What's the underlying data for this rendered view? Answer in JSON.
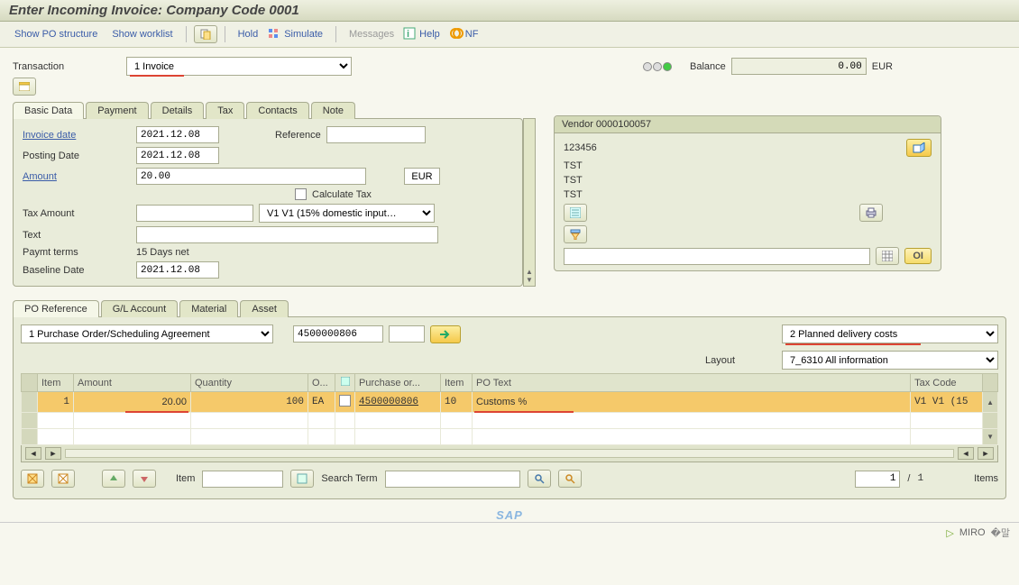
{
  "title": "Enter Incoming Invoice: Company Code 0001",
  "toolbar": {
    "show_po": "Show PO structure",
    "show_worklist": "Show worklist",
    "hold": "Hold",
    "simulate": "Simulate",
    "messages": "Messages",
    "help": "Help",
    "nf": "NF"
  },
  "transaction_lbl": "Transaction",
  "transaction_val": "1 Invoice",
  "balance_lbl": "Balance",
  "balance_val": "0.00",
  "balance_cur": "EUR",
  "tabs1": {
    "basic": "Basic Data",
    "payment": "Payment",
    "details": "Details",
    "tax": "Tax",
    "contacts": "Contacts",
    "note": "Note"
  },
  "basic": {
    "invoice_date_lbl": "Invoice date",
    "invoice_date": "2021.12.08",
    "reference_lbl": "Reference",
    "reference": "",
    "posting_date_lbl": "Posting Date",
    "posting_date": "2021.12.08",
    "amount_lbl": "Amount",
    "amount": "20.00",
    "amount_cur": "EUR",
    "calc_tax_lbl": "Calculate Tax",
    "tax_amount_lbl": "Tax Amount",
    "tax_amount": "",
    "tax_code": "V1 V1 (15% domestic input…",
    "text_lbl": "Text",
    "text": "",
    "paymt_lbl": "Paymt terms",
    "paymt": "15 Days net",
    "baseline_lbl": "Baseline Date",
    "baseline": "2021.12.08"
  },
  "vendor": {
    "header": "Vendor 0000100057",
    "l1": "123456",
    "l2": "TST",
    "l3": "TST",
    "l4": "TST",
    "oi": "OI"
  },
  "tabs2": {
    "po": "PO Reference",
    "gl": "G/L Account",
    "mat": "Material",
    "asset": "Asset"
  },
  "po_sel": "1 Purchase Order/Scheduling Agreement",
  "po_num": "4500000806",
  "cost_sel": "2 Planned delivery costs",
  "layout_lbl": "Layout",
  "layout_sel": "7_6310 All information",
  "grid": {
    "h_item": "Item",
    "h_amount": "Amount",
    "h_qty": "Quantity",
    "h_o": "O...",
    "h_po": "Purchase or...",
    "h_item2": "Item",
    "h_text": "PO Text",
    "h_tax": "Tax Code",
    "r_item": "1",
    "r_amount": "20.00",
    "r_qty": "100",
    "r_unit": "EA",
    "r_po": "4500000806",
    "r_item2": "10",
    "r_text": "Customs %",
    "r_tax": "V1 V1 (15"
  },
  "footer": {
    "item_lbl": "Item",
    "search_lbl": "Search Term",
    "page": "1",
    "sep": "/",
    "total": "1",
    "items": "Items"
  },
  "status": {
    "tcode": "MIRO"
  }
}
